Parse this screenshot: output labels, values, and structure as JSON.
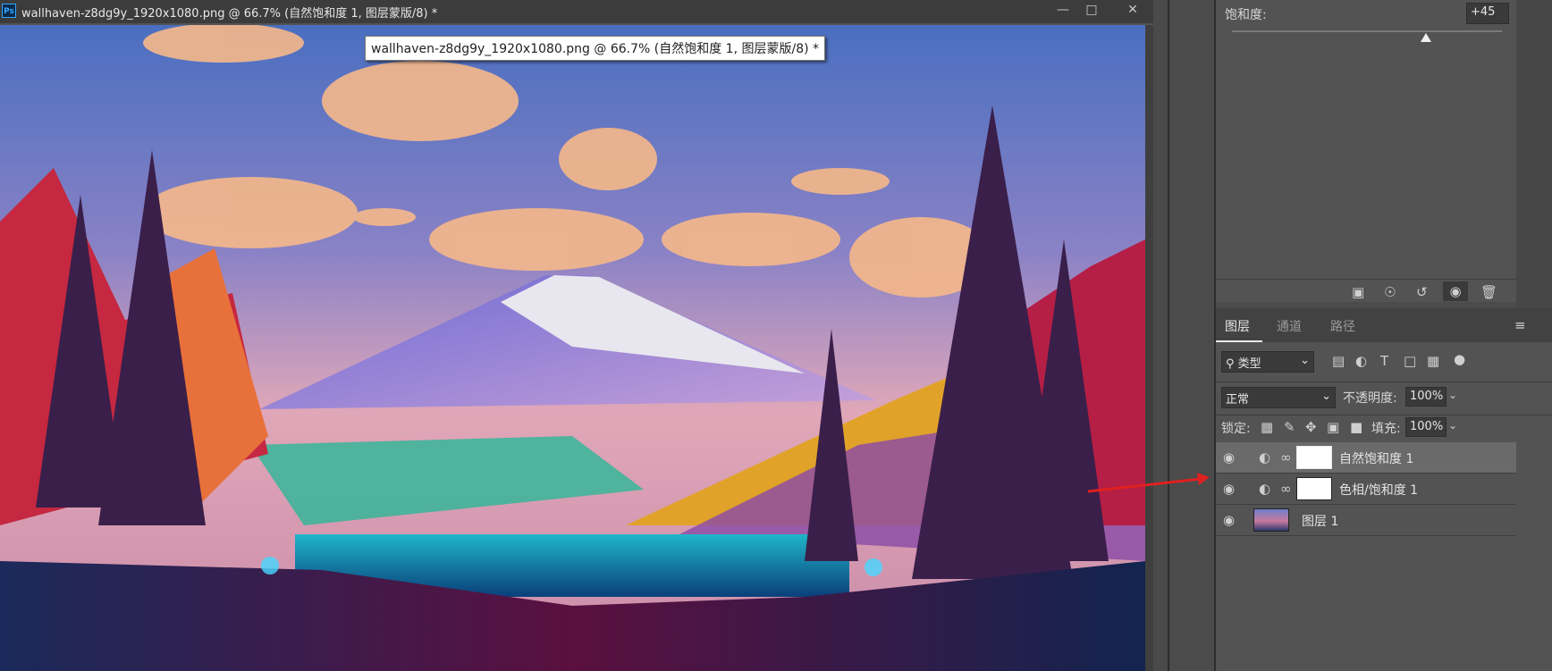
{
  "window": {
    "title": "wallhaven-z8dg9y_1920x1080.png @ 66.7% (自然饱和度 1, 图层蒙版/8) *",
    "app_icon": "Ps",
    "controls": [
      "minimize-icon",
      "maximize-icon",
      "close-icon"
    ]
  },
  "tooltip": {
    "text": "wallhaven-z8dg9y_1920x1080.png @ 66.7% (自然饱和度 1, 图层蒙版/8) *"
  },
  "properties": {
    "saturation_label": "饱和度:",
    "saturation_value": "+45",
    "saturation_slider_fraction": 0.72,
    "footer_icons": [
      "clip-to-layer-icon",
      "view-previous-state-icon",
      "reset-icon",
      "visibility-icon",
      "delete-icon"
    ]
  },
  "layers_panel": {
    "tabs": [
      "图层",
      "通道",
      "路径"
    ],
    "active_tab": "图层",
    "filter_label": "类型",
    "blend_mode": "正常",
    "opacity_label": "不透明度:",
    "opacity_value": "100%",
    "lock_label": "锁定:",
    "fill_label": "填充:",
    "fill_value": "100%",
    "layers": [
      {
        "name": "自然饱和度 1",
        "selected": true
      },
      {
        "name": "色相/饱和度 1",
        "selected": false
      },
      {
        "name": "图层 1",
        "selected": false
      }
    ]
  },
  "colors": {
    "annotation_arrow": "#e02020",
    "selected_row": "#6a6a6a",
    "panel_bg": "#535353"
  }
}
